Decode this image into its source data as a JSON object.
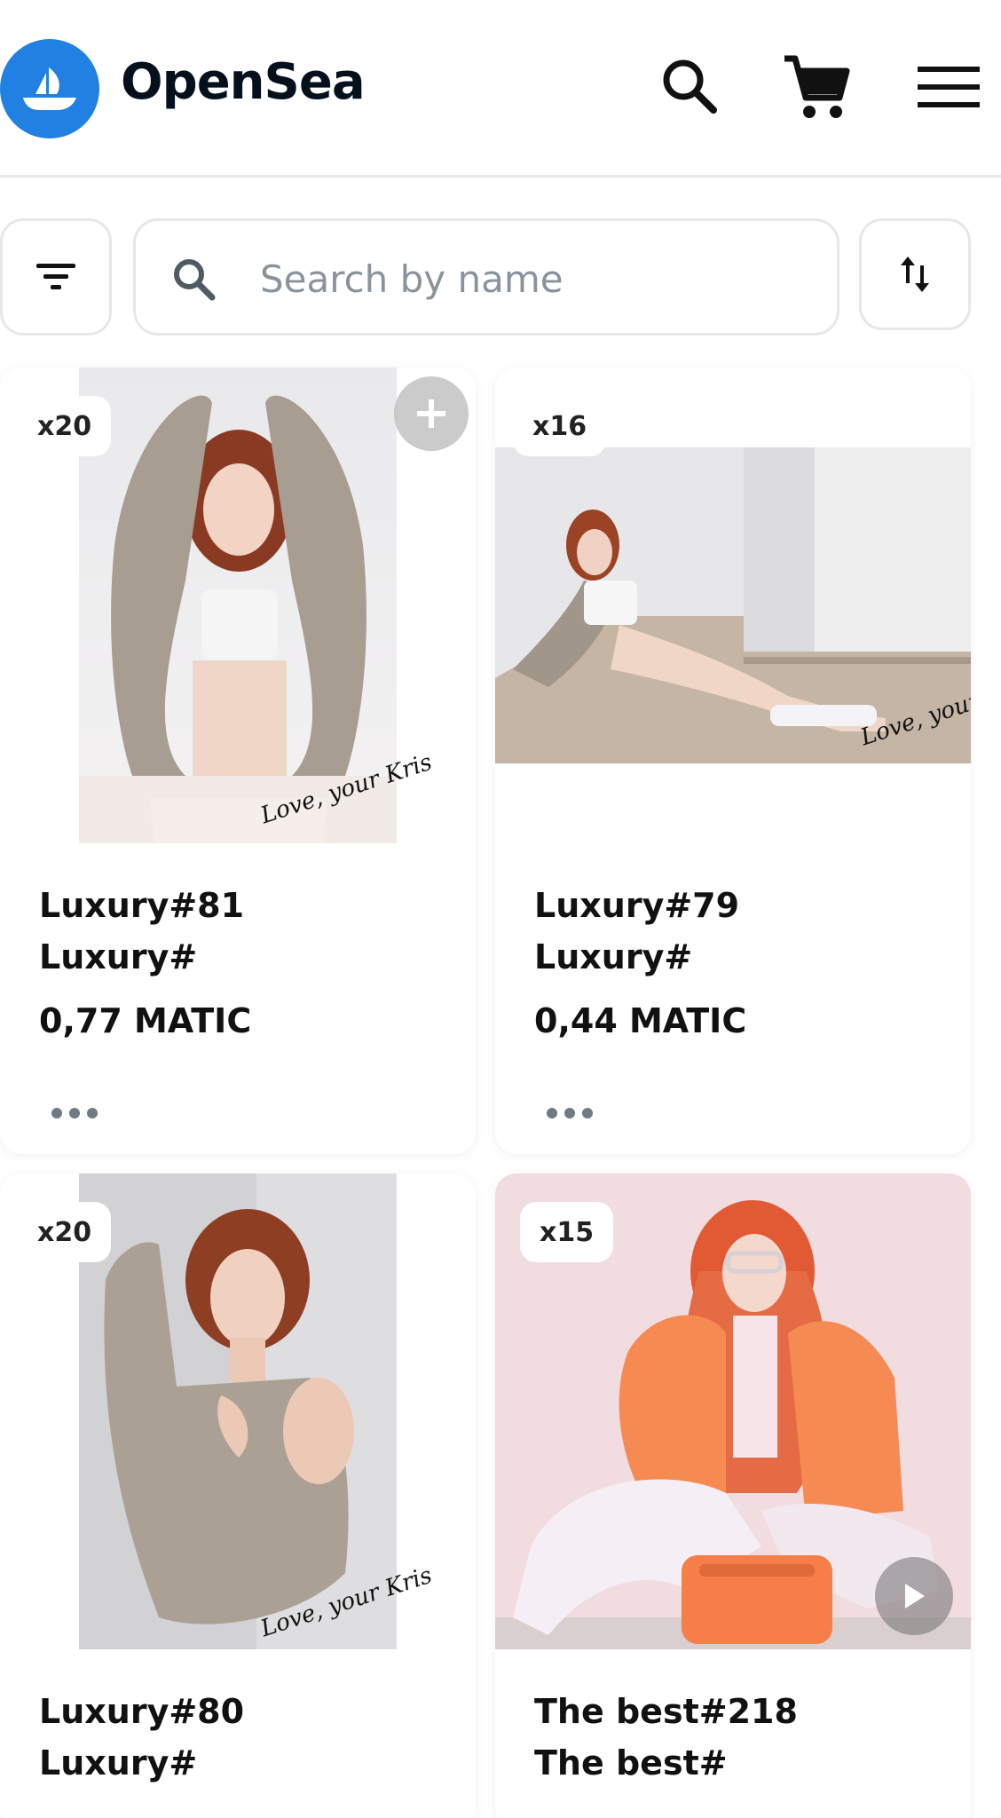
{
  "header": {
    "brand": "OpenSea",
    "brand_color": "#2081e2",
    "icons": [
      "search-icon",
      "cart-icon",
      "menu-icon"
    ]
  },
  "toolbar": {
    "search_placeholder": "Search by name",
    "icons": [
      "filter-icon",
      "search-icon",
      "sort-icon"
    ]
  },
  "items": [
    {
      "quantity": "x20",
      "name": "Luxury#81",
      "collection": "Luxury#",
      "price": "0,77 MATIC",
      "photo": "woman in beige knit cardigan, arms raised",
      "signature": "Love, your Kris"
    },
    {
      "quantity": "x16",
      "name": "Luxury#79",
      "collection": "Luxury#",
      "price": "0,44 MATIC",
      "photo": "woman reclining on beige sofa",
      "signature": "Love, your Kris"
    },
    {
      "quantity": "x20",
      "name": "Luxury#80",
      "collection": "Luxury#",
      "photo": "woman in oversized beige knit sweater",
      "signature": "Love, your Kris"
    },
    {
      "quantity": "x15",
      "name": "The best#218",
      "collection": "The best#",
      "photo": "woman in orange puffer jacket with orange bag"
    }
  ]
}
